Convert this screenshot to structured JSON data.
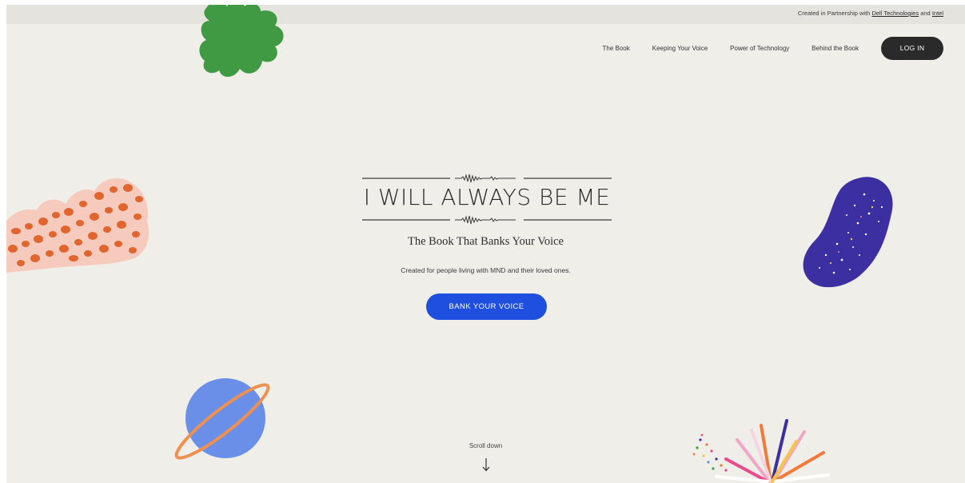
{
  "topbar": {
    "prefix": "Created in Partnership with",
    "partner1": "Dell Technologies",
    "and": "and",
    "partner2": "Intel"
  },
  "nav": {
    "items": [
      "The Book",
      "Keeping Your Voice",
      "Power of Technology",
      "Behind the Book"
    ],
    "login": "LOG IN"
  },
  "hero": {
    "logo_text": "I WILL ALWAYS BE ME",
    "subtitle": "The Book That Banks Your Voice",
    "tagline": "Created for people living with MND and their loved ones.",
    "cta": "BANK YOUR VOICE"
  },
  "scroll": {
    "label": "Scroll down",
    "arrow": "↓"
  },
  "decorations": {
    "leaf": {
      "icon": "leaf-shape",
      "color": "#3f9a43"
    },
    "spotted_cloud": {
      "icon": "spotted-blob",
      "color": "#f6cbbd",
      "spot_color": "#e0652f"
    },
    "starry_blob": {
      "icon": "starry-blob",
      "color": "#3b2fa1"
    },
    "planet": {
      "icon": "planet",
      "color": "#6a8fe8",
      "ring_color": "#f0904f"
    },
    "burst": {
      "icon": "color-burst"
    }
  },
  "colors": {
    "background": "#f0eee8",
    "accent": "#1f4fde",
    "login_bg": "#2a2a2a"
  }
}
